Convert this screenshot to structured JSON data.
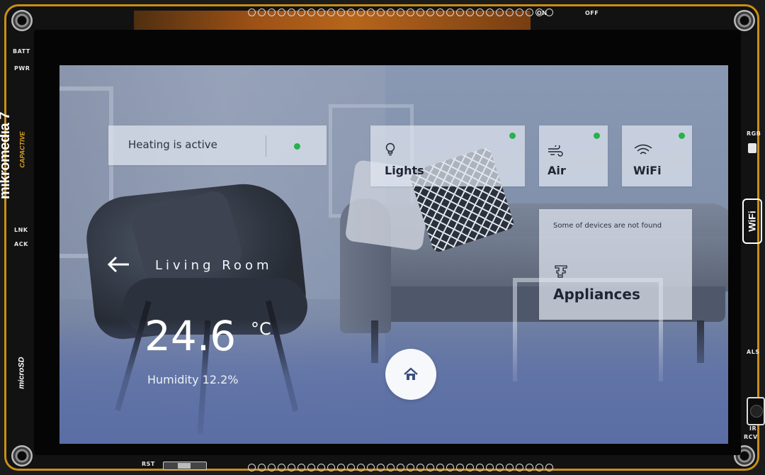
{
  "board": {
    "brand": "mikromedia 7",
    "brand_sub": "CAPACTIVE",
    "micro_sd": "microSD",
    "wifi_logo": "WiFi",
    "labels": {
      "on": "ON",
      "off": "OFF",
      "batt": "BATT",
      "pwr": "PWR",
      "lnk": "LNK",
      "ack": "ACK",
      "rgb": "RGB",
      "als": "ALS",
      "ir": "IR",
      "rcv": "RCV",
      "rst": "RST"
    }
  },
  "screen": {
    "heating": {
      "text": "Heating is active",
      "status_color": "#27b24a"
    },
    "tiles": [
      {
        "label": "Lights",
        "icon": "lightbulb-icon",
        "status_color": "#27b24a"
      },
      {
        "label": "Air",
        "icon": "air-flow-icon",
        "status_color": "#27b24a"
      },
      {
        "label": "WiFi",
        "icon": "wifi-icon",
        "status_color": "#27b24a"
      }
    ],
    "appliances": {
      "notice": "Some of devices are not found",
      "label": "Appliances",
      "icon": "appliance-icon"
    },
    "room": {
      "title": "Living Room",
      "back_icon": "back-arrow-icon"
    },
    "climate": {
      "temperature": "24.6",
      "unit": "°C",
      "humidity": "Humidity 12.2%"
    },
    "home_button": {
      "icon": "home-icon"
    }
  },
  "colors": {
    "status_green": "#27b24a",
    "board_edge": "#c98f13",
    "card_background": "rgba(225,230,240,0.72)"
  }
}
